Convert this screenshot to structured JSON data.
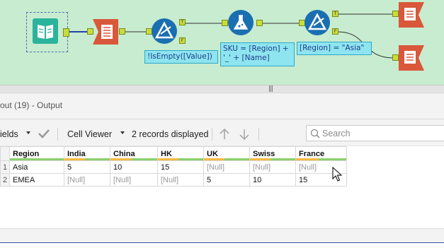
{
  "canvas": {
    "tools": [
      {
        "name": "input-data-tool",
        "icon": "book-icon"
      },
      {
        "name": "select-tool",
        "icon": "select-list-icon"
      },
      {
        "name": "filter-tool-isempty",
        "icon": "filter-triangle-icon"
      },
      {
        "name": "formula-tool",
        "icon": "flask-icon"
      },
      {
        "name": "filter-tool-region",
        "icon": "filter-triangle-icon"
      },
      {
        "name": "output-tool-true",
        "icon": "output-icon"
      },
      {
        "name": "output-tool-false",
        "icon": "output-icon"
      }
    ],
    "notes": {
      "filter1": "!IsEmpty([Value])",
      "formula": "SKU = [Region] +\n'_' + [Name]",
      "filter2": "[Region] = \"Asia\""
    },
    "anchor_labels": {
      "true": "T",
      "false": "F"
    }
  },
  "splitter": {
    "grip": "|||"
  },
  "pane": {
    "title": "out (19) - Output",
    "toolbar": {
      "fields_label": "ields",
      "viewer_label": "Cell Viewer",
      "records_label": "2 records displayed",
      "search_placeholder": "Search"
    }
  },
  "grid": {
    "columns": [
      "Region",
      "India",
      "China",
      "HK",
      "UK",
      "Swiss",
      "France"
    ],
    "rows": [
      {
        "num": "1",
        "cells": [
          "Asia",
          "5",
          "10",
          "15",
          "[Null]",
          "[Null]",
          "[Null]"
        ]
      },
      {
        "num": "2",
        "cells": [
          "EMEA",
          "[Null]",
          "[Null]",
          "[Null]",
          "5",
          "10",
          "15"
        ]
      }
    ]
  },
  "colors": {
    "canvas_bg": "#c7eccf",
    "note_bg": "#8ee4ef",
    "header_bar_green": "#8bd06b",
    "header_bar_orange": "#f5b942",
    "null_text": "#9a9a9a"
  }
}
